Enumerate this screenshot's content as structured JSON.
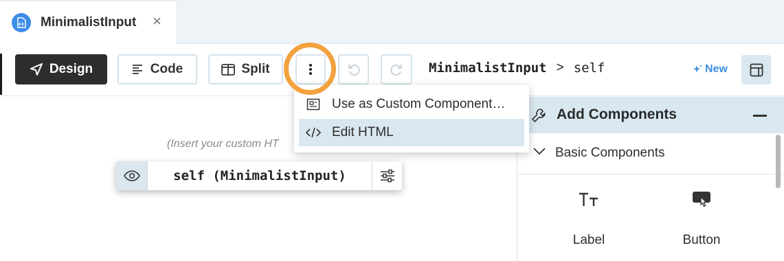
{
  "tab": {
    "title": "MinimalistInput",
    "close": "×"
  },
  "toolbar": {
    "design_label": "Design",
    "code_label": "Code",
    "split_label": "Split",
    "more_icon": "more-vertical-icon",
    "undo_icon": "undo-icon",
    "redo_icon": "redo-icon"
  },
  "breadcrumb": {
    "component": "MinimalistInput",
    "separator": ">",
    "item": "self"
  },
  "new_label": "New",
  "menu": {
    "items": [
      {
        "label": "Use as Custom Component…",
        "icon": "custom-component-icon"
      },
      {
        "label": "Edit HTML",
        "icon": "code-icon",
        "highlighted": true
      }
    ]
  },
  "canvas": {
    "placeholder": "(Insert your custom HT",
    "selection_label": "self (MinimalistInput)"
  },
  "panel": {
    "title": "Add Components",
    "section": "Basic Components",
    "components": [
      {
        "label": "Label",
        "icon": "label-icon"
      },
      {
        "label": "Button",
        "icon": "button-icon"
      }
    ]
  },
  "colors": {
    "accent": "#3d8fe0",
    "highlight_ring": "#f3a23f",
    "selected_bg": "#d9e7f0",
    "design_bg": "#2d2d2d"
  }
}
